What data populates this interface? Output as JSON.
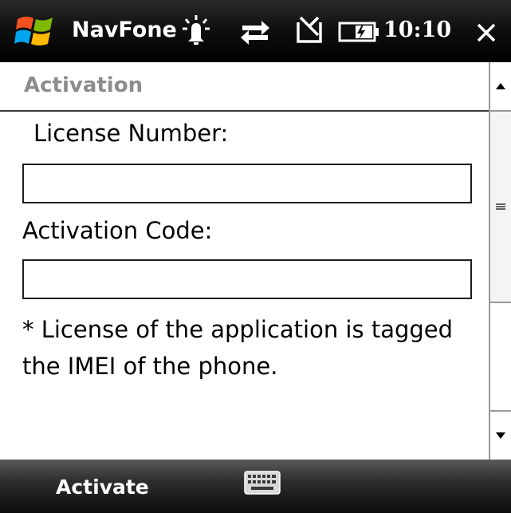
{
  "status_bar": {
    "app_name": "NavFone",
    "time": "10:10",
    "icons": [
      "windows-start-icon",
      "notification-icon",
      "data-sync-icon",
      "signal-off-icon",
      "battery-icon",
      "close-icon"
    ]
  },
  "page": {
    "title": "Activation"
  },
  "form": {
    "license_label": "License Number:",
    "license_value": "",
    "activation_label": "Activation Code:",
    "activation_value": "",
    "note": "* License of the application is tagged the IMEI of the phone."
  },
  "softkeys": {
    "left_label": "Activate",
    "center_icon": "keyboard-icon"
  }
}
